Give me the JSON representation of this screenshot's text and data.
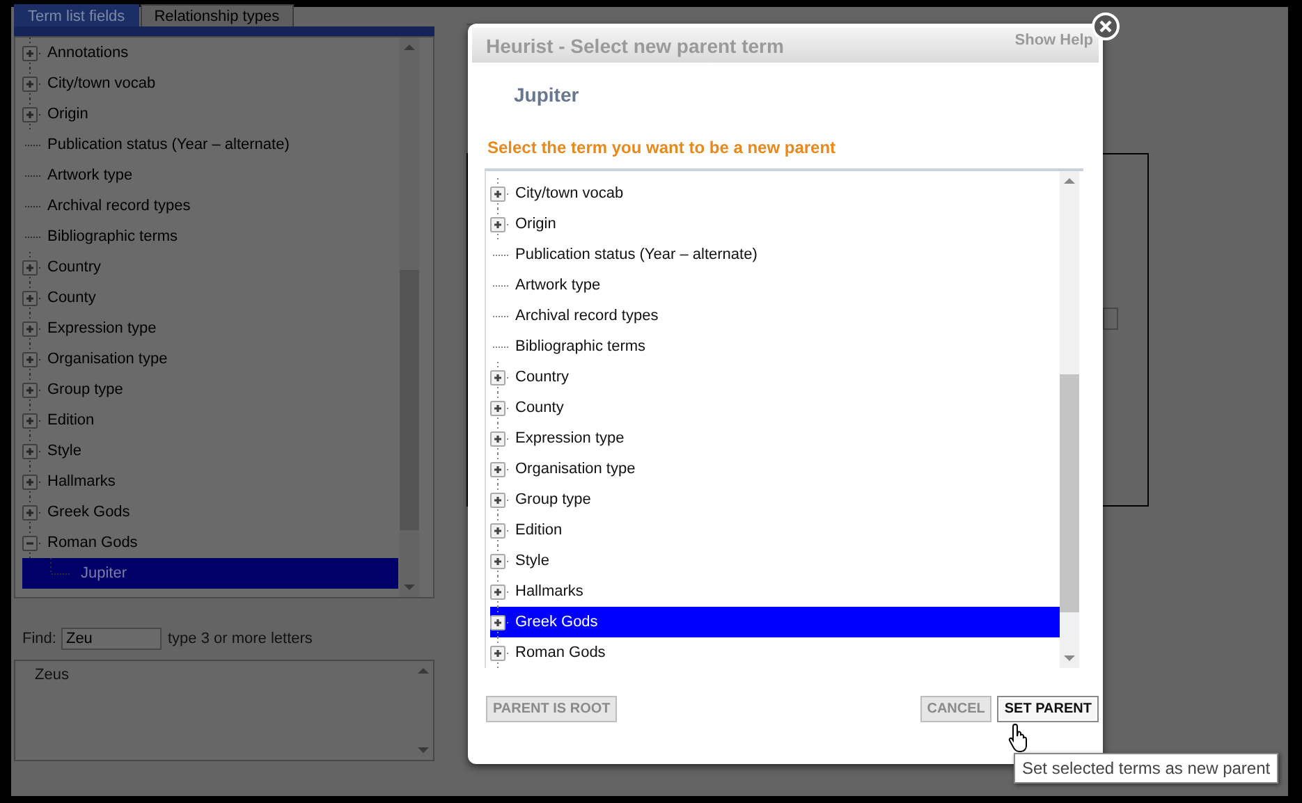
{
  "tabs": [
    {
      "label": "Term list fields",
      "selected": true
    },
    {
      "label": "Relationship types",
      "selected": false
    }
  ],
  "term_tree": {
    "items": [
      {
        "label": "Annotations",
        "kind": "branch",
        "expanded": false,
        "selected": false
      },
      {
        "label": "City/town vocab",
        "kind": "branch",
        "expanded": false,
        "selected": false
      },
      {
        "label": "Origin",
        "kind": "branch",
        "expanded": false,
        "selected": false
      },
      {
        "label": "Publication status (Year – alternate)",
        "kind": "leaf",
        "selected": false
      },
      {
        "label": "Artwork type",
        "kind": "leaf",
        "selected": false
      },
      {
        "label": "Archival record types",
        "kind": "leaf",
        "selected": false
      },
      {
        "label": "Bibliographic terms",
        "kind": "leaf",
        "selected": false
      },
      {
        "label": "Country",
        "kind": "branch",
        "expanded": false,
        "selected": false
      },
      {
        "label": "County",
        "kind": "branch",
        "expanded": false,
        "selected": false
      },
      {
        "label": "Expression type",
        "kind": "branch",
        "expanded": false,
        "selected": false
      },
      {
        "label": "Organisation type",
        "kind": "branch",
        "expanded": false,
        "selected": false
      },
      {
        "label": "Group type",
        "kind": "branch",
        "expanded": false,
        "selected": false
      },
      {
        "label": "Edition",
        "kind": "branch",
        "expanded": false,
        "selected": false
      },
      {
        "label": "Style",
        "kind": "branch",
        "expanded": false,
        "selected": false
      },
      {
        "label": "Hallmarks",
        "kind": "branch",
        "expanded": false,
        "selected": false
      },
      {
        "label": "Greek Gods",
        "kind": "branch",
        "expanded": false,
        "selected": false
      },
      {
        "label": "Roman Gods",
        "kind": "branch",
        "expanded": true,
        "selected": false,
        "children": [
          {
            "label": "Jupiter",
            "kind": "leaf",
            "selected": true
          }
        ]
      }
    ]
  },
  "find": {
    "label": "Find:",
    "value": "Zeu",
    "hint": "type 3 or more letters",
    "results": [
      "Zeus"
    ]
  },
  "dialog": {
    "title": "Heurist - Select new parent term",
    "help": "Show Help",
    "term": "Jupiter",
    "instruction": "Select the term you want to be a new parent",
    "tree": {
      "items": [
        {
          "label": "City/town vocab",
          "kind": "branch",
          "expanded": false,
          "selected": false
        },
        {
          "label": "Origin",
          "kind": "branch",
          "expanded": false,
          "selected": false
        },
        {
          "label": "Publication status (Year – alternate)",
          "kind": "leaf",
          "selected": false
        },
        {
          "label": "Artwork type",
          "kind": "leaf",
          "selected": false
        },
        {
          "label": "Archival record types",
          "kind": "leaf",
          "selected": false
        },
        {
          "label": "Bibliographic terms",
          "kind": "leaf",
          "selected": false
        },
        {
          "label": "Country",
          "kind": "branch",
          "expanded": false,
          "selected": false
        },
        {
          "label": "County",
          "kind": "branch",
          "expanded": false,
          "selected": false
        },
        {
          "label": "Expression type",
          "kind": "branch",
          "expanded": false,
          "selected": false
        },
        {
          "label": "Organisation type",
          "kind": "branch",
          "expanded": false,
          "selected": false
        },
        {
          "label": "Group type",
          "kind": "branch",
          "expanded": false,
          "selected": false
        },
        {
          "label": "Edition",
          "kind": "branch",
          "expanded": false,
          "selected": false
        },
        {
          "label": "Style",
          "kind": "branch",
          "expanded": false,
          "selected": false
        },
        {
          "label": "Hallmarks",
          "kind": "branch",
          "expanded": false,
          "selected": false
        },
        {
          "label": "Greek Gods",
          "kind": "branch",
          "expanded": false,
          "selected": true
        },
        {
          "label": "Roman Gods",
          "kind": "branch",
          "expanded": false,
          "selected": false
        }
      ]
    },
    "buttons": [
      {
        "label": "PARENT IS ROOT",
        "hovered": false
      },
      {
        "label": "CANCEL",
        "hovered": false
      },
      {
        "label": "SET PARENT",
        "hovered": true
      }
    ],
    "tooltip": "Set selected terms as new parent"
  }
}
